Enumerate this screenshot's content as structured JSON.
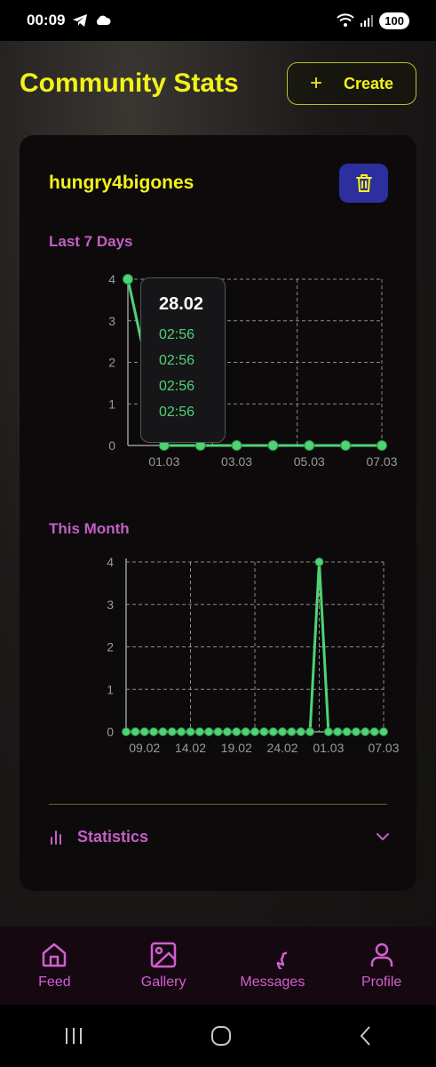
{
  "status_bar": {
    "time": "00:09",
    "battery": "100"
  },
  "header": {
    "title": "Community Stats",
    "create_label": "Create"
  },
  "card": {
    "username": "hungry4bigones",
    "last7_label": "Last 7 Days",
    "month_label": "This Month",
    "statistics_label": "Statistics"
  },
  "tooltip": {
    "date": "28.02",
    "times": [
      "02:56",
      "02:56",
      "02:56",
      "02:56"
    ]
  },
  "nav": {
    "items": [
      {
        "label": "Feed",
        "icon": "home-icon"
      },
      {
        "label": "Gallery",
        "icon": "image-icon"
      },
      {
        "label": "Messages",
        "icon": "chat-bubble-icon"
      },
      {
        "label": "Profile",
        "icon": "user-icon"
      }
    ]
  },
  "colors": {
    "accent_yellow": "#f2f21a",
    "accent_purple": "#c45fc5",
    "line_green": "#4fd374",
    "delete_blue": "#2d2f9e"
  },
  "chart_data": [
    {
      "type": "line",
      "title": "Last 7 Days",
      "x": [
        "28.02",
        "01.03",
        "02.03",
        "03.03",
        "04.03",
        "05.03",
        "06.03",
        "07.03"
      ],
      "x_tick_labels": [
        "01.03",
        "03.03",
        "05.03",
        "07.03"
      ],
      "values": [
        4,
        0,
        0,
        0,
        0,
        0,
        0,
        0
      ],
      "ylim": [
        0,
        4
      ],
      "y_ticks": [
        0,
        1,
        2,
        3,
        4
      ],
      "grid": true
    },
    {
      "type": "line",
      "title": "This Month",
      "x": [
        "07.02",
        "08.02",
        "09.02",
        "10.02",
        "11.02",
        "12.02",
        "13.02",
        "14.02",
        "15.02",
        "16.02",
        "17.02",
        "18.02",
        "19.02",
        "20.02",
        "21.02",
        "22.02",
        "23.02",
        "24.02",
        "25.02",
        "26.02",
        "27.02",
        "28.02",
        "01.03",
        "02.03",
        "03.03",
        "04.03",
        "05.03",
        "06.03",
        "07.03"
      ],
      "x_tick_labels": [
        "09.02",
        "14.02",
        "19.02",
        "24.02",
        "01.03",
        "07.03"
      ],
      "values": [
        0,
        0,
        0,
        0,
        0,
        0,
        0,
        0,
        0,
        0,
        0,
        0,
        0,
        0,
        0,
        0,
        0,
        0,
        0,
        0,
        0,
        4,
        0,
        0,
        0,
        0,
        0,
        0,
        0
      ],
      "ylim": [
        0,
        4
      ],
      "y_ticks": [
        0,
        1,
        2,
        3,
        4
      ],
      "grid": true
    }
  ]
}
